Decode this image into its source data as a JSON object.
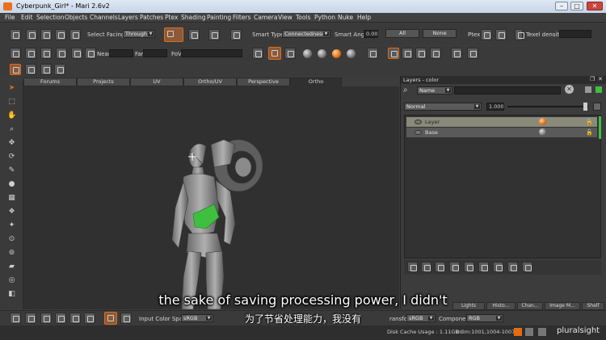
{
  "window": {
    "title": "Cyberpunk_Girl* - Mari 2.6v2",
    "controls": [
      "minimize",
      "maximize",
      "close"
    ]
  },
  "menu": [
    "File",
    "Edit",
    "Selection",
    "Objects",
    "Channels",
    "Layers",
    "Patches",
    "Ptex",
    "Shading",
    "Painting",
    "Filters",
    "Camera",
    "View",
    "Tools",
    "Python",
    "Nuke",
    "Help"
  ],
  "toolbar1": {
    "select_label": "Select",
    "facing_label": "Facing",
    "facing_value": "Through",
    "smart_type_label": "Smart Type:",
    "smart_type_value": "Connectedness",
    "smart_angle_label": "Smart Angle",
    "smart_angle_value": "0.00",
    "all_label": "All",
    "none_label": "None",
    "ptex_label": "Ptex",
    "texel_density_label": "Texel density :",
    "texel_density_value": ""
  },
  "toolbar2": {
    "near_label": "Near",
    "far_label": "Far",
    "fov_label": "FoV"
  },
  "view_tabs": [
    "Forums",
    "Projects",
    "UV",
    "Ortho/UV",
    "Perspective",
    "Ortho"
  ],
  "active_view_tab": "Ortho",
  "layers_panel": {
    "title": "Layers - color",
    "name_dropdown": "Name",
    "blend_mode": "Normal",
    "opacity": "1.000",
    "layers": [
      {
        "name": "Layer",
        "selected": true
      },
      {
        "name": "Base",
        "selected": false
      }
    ]
  },
  "panel_tabs": [
    "Lights",
    "Histo...",
    "Chan...",
    "Image M...",
    "Shelf"
  ],
  "bottom_bar": {
    "input_color_space_label": "Input Color Space",
    "input_color_space_value": "sRGB",
    "transform_label": "ransform",
    "transform_value": "sRGB",
    "component_label": "Component",
    "component_value": "RGB"
  },
  "status": {
    "disk_cache": "Disk Cache Usage : 1.11GB",
    "udim": "Udim:1001,1004-1007"
  },
  "subtitle": {
    "en": "the sake of saving processing power, I didn't",
    "zh": "为了节省处理能力，我没有"
  },
  "watermark": "pluralsight",
  "colors": {
    "accent": "#e56c10",
    "selection": "#3fbf3f",
    "panel": "#3c3c3c",
    "viewport": "#303030"
  }
}
